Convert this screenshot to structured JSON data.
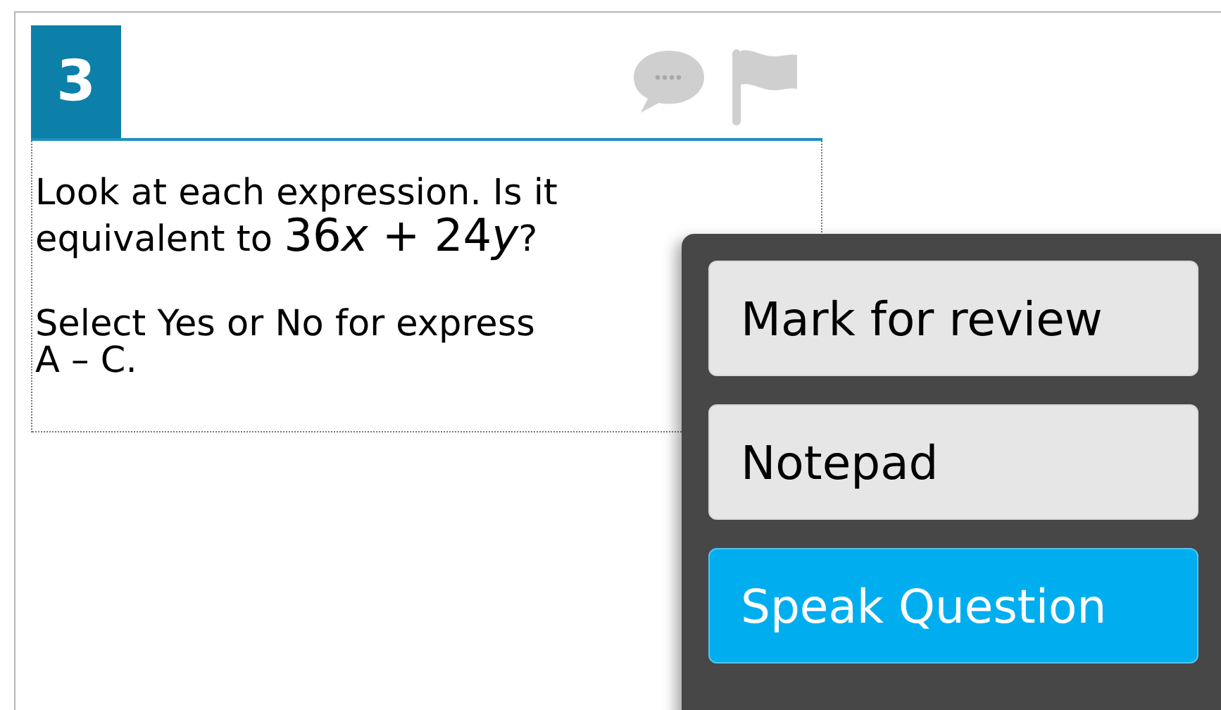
{
  "question": {
    "number": "3",
    "prompt": {
      "text": "Look at each expression. Is it equivalent to ",
      "expression": [
        {
          "kind": "number",
          "text": "36"
        },
        {
          "kind": "variable",
          "text": "x"
        },
        {
          "kind": "number",
          "text": " + 24"
        },
        {
          "kind": "variable",
          "text": "y"
        }
      ],
      "tail": "?"
    },
    "instruction_lines": [
      "Select Yes or No for express",
      "A – C."
    ]
  },
  "context_menu": {
    "items": [
      {
        "label": "Mark for review",
        "selected": false
      },
      {
        "label": "Notepad",
        "selected": false
      },
      {
        "label": "Speak Question",
        "selected": true
      }
    ]
  }
}
